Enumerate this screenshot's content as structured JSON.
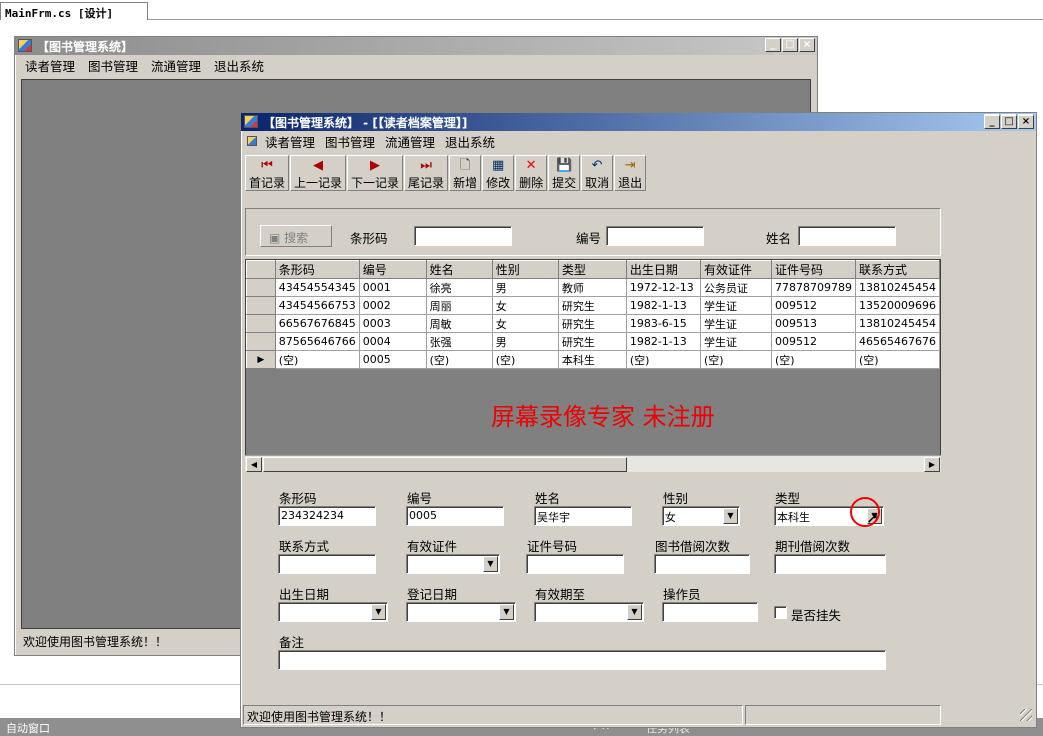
{
  "ide": {
    "doc_tab": "MainFrm.cs [设计]",
    "status_left": "自动窗口",
    "status_mid": "▾ ✕",
    "status_right": "任务列表"
  },
  "main_window": {
    "title": "【图书管理系统】",
    "menu": [
      "读者管理",
      "图书管理",
      "流通管理",
      "退出系统"
    ],
    "status": "欢迎使用图书管理系统！！",
    "btn_min": "_",
    "btn_max": "□",
    "btn_close": "×"
  },
  "child_window": {
    "title": "【图书管理系统】 - [【读者档案管理】]",
    "menu": [
      "读者管理",
      "图书管理",
      "流通管理",
      "退出系统"
    ],
    "toolbar": [
      {
        "label": "首记录",
        "icon": "first-record-icon",
        "glyph": "⏮"
      },
      {
        "label": "上一记录",
        "icon": "prev-record-icon",
        "glyph": "◀"
      },
      {
        "label": "下一记录",
        "icon": "next-record-icon",
        "glyph": "▶"
      },
      {
        "label": "尾记录",
        "icon": "last-record-icon",
        "glyph": "⏭"
      },
      {
        "label": "新增",
        "icon": "new-doc-icon",
        "glyph": "🗋"
      },
      {
        "label": "修改",
        "icon": "edit-icon",
        "glyph": "▦"
      },
      {
        "label": "删除",
        "icon": "delete-icon",
        "glyph": "✕"
      },
      {
        "label": "提交",
        "icon": "save-icon",
        "glyph": "💾"
      },
      {
        "label": "取消",
        "icon": "undo-icon",
        "glyph": "↶"
      },
      {
        "label": "退出",
        "icon": "exit-icon",
        "glyph": "⇥"
      }
    ],
    "search": {
      "button": "搜索",
      "barcode_label": "条形码",
      "id_label": "编号",
      "name_label": "姓名"
    },
    "grid": {
      "columns": [
        "条形码",
        "编号",
        "姓名",
        "性别",
        "类型",
        "出生日期",
        "有效证件",
        "证件号码",
        "联系方式"
      ],
      "rows": [
        [
          "43454554345",
          "0001",
          "徐亮",
          "男",
          "教师",
          "1972-12-13",
          "公务员证",
          "77878709789",
          "13810245454"
        ],
        [
          "43454566753",
          "0002",
          "周丽",
          "女",
          "研究生",
          "1982-1-13",
          "学生证",
          "009512",
          "13520009696"
        ],
        [
          "66567676845",
          "0003",
          "周敏",
          "女",
          "研究生",
          "1983-6-15",
          "学生证",
          "009513",
          "13810245454"
        ],
        [
          "87565646766",
          "0004",
          "张强",
          "男",
          "研究生",
          "1982-1-13",
          "学生证",
          "009512",
          "46565467676"
        ],
        [
          "(空)",
          "0005",
          "(空)",
          "(空)",
          "本科生",
          "(空)",
          "(空)",
          "(空)",
          "(空)"
        ]
      ],
      "current_row_marker": "▶"
    },
    "watermark": "屏幕录像专家  未注册",
    "form": {
      "barcode_label": "条形码",
      "barcode_value": "234324234",
      "id_label": "编号",
      "id_value": "0005",
      "name_label": "姓名",
      "name_value": "吴华宇",
      "gender_label": "性别",
      "gender_value": "女",
      "type_label": "类型",
      "type_value": "本科生",
      "contact_label": "联系方式",
      "cert_label": "有效证件",
      "cert_no_label": "证件号码",
      "book_borrow_label": "图书借阅次数",
      "journal_borrow_label": "期刊借阅次数",
      "birth_label": "出生日期",
      "reg_label": "登记日期",
      "valid_label": "有效期至",
      "operator_label": "操作员",
      "lost_label": "是否挂失",
      "remark_label": "备注"
    },
    "status": "欢迎使用图书管理系统！！"
  }
}
